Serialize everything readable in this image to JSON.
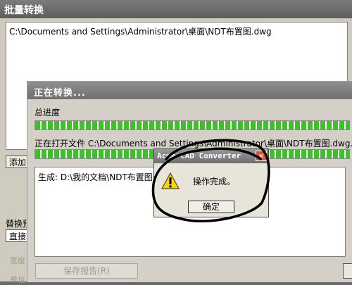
{
  "batch_window": {
    "title": "批量转换",
    "file_list": [
      "C:\\Documents and Settings\\Administrator\\桌面\\NDT布置图.dwg"
    ],
    "add_button": "添加",
    "replace_label": "替换预",
    "select_value": "直接转",
    "width_label": "宽度",
    "unit_label": "单位"
  },
  "progress_window": {
    "title": "正在转换...",
    "overall_label": "总进度",
    "overall_progress": 1.0,
    "opening_label": "正在打开文件 C:\\Documents and Settings\\Administrator\\桌面\\NDT布置图.dwg...",
    "file_progress": 1.0,
    "log_line": "生成: D:\\我的文档\\NDT布置图.dwg",
    "save_report_button": "保存报告(R)"
  },
  "message_dialog": {
    "title": "Acme CAD Converter",
    "message": "操作完成。",
    "ok_button": "确定",
    "close_glyph": "✕",
    "icon": "warning-icon"
  },
  "colors": {
    "progress_fill": "#3fbf2a",
    "close_button": "#d9533a",
    "ink": "#000000"
  }
}
